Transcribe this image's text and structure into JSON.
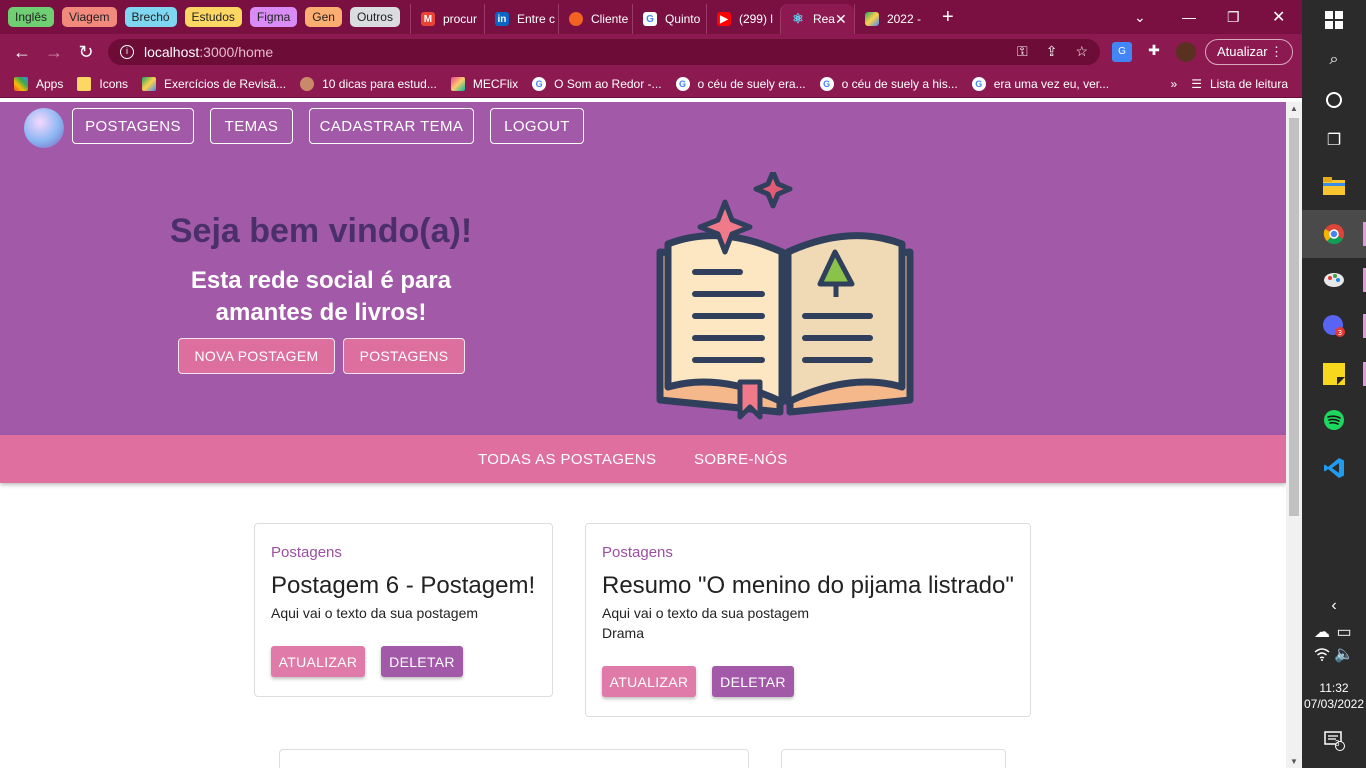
{
  "browser": {
    "tab_groups": [
      {
        "label": "Inglês",
        "color": "#6fcf72"
      },
      {
        "label": "Viagem",
        "color": "#f2897d"
      },
      {
        "label": "Brechó",
        "color": "#7ed6f0"
      },
      {
        "label": "Estudos",
        "color": "#fdd663"
      },
      {
        "label": "Figma",
        "color": "#d98cf5"
      },
      {
        "label": "Gen",
        "color": "#fcad70"
      },
      {
        "label": "Outros",
        "color": "#dadce0"
      }
    ],
    "tabs": [
      {
        "label": "procur",
        "icon": "gmail-icon",
        "color": "#ea4335"
      },
      {
        "label": "Entre c",
        "icon": "linkedin-icon",
        "color": "#0a66c2"
      },
      {
        "label": "Cliente",
        "icon": "app-icon",
        "color": "#f26322"
      },
      {
        "label": "Quinto",
        "icon": "g-icon",
        "color": "#4285f4"
      },
      {
        "label": "(299) l",
        "icon": "youtube-icon",
        "color": "#ff0000"
      },
      {
        "label": "Rea",
        "icon": "react-icon",
        "color": "#61dafb",
        "active": true
      },
      {
        "label": "2022 -",
        "icon": "drive-icon",
        "color": "#1fa463"
      }
    ],
    "url_host": "localhost",
    "url_path": ":3000/home",
    "update_label": "Atualizar",
    "bookmarks": [
      {
        "label": "Apps",
        "icon": "apps-grid-icon"
      },
      {
        "label": "Icons",
        "icon": "folder-icon"
      },
      {
        "label": "Exercícios de Revisã...",
        "icon": "drive-icon"
      },
      {
        "label": "10 dicas para estud...",
        "icon": "avatar-icon"
      },
      {
        "label": "MECFlix",
        "icon": "mecflix-icon"
      },
      {
        "label": "O Som ao Redor -...",
        "icon": "google-icon"
      },
      {
        "label": "o céu de suely era...",
        "icon": "google-icon"
      },
      {
        "label": "o céu de suely a his...",
        "icon": "google-icon"
      },
      {
        "label": "era uma vez eu, ver...",
        "icon": "google-icon"
      }
    ],
    "reading_list": "Lista de leitura"
  },
  "app": {
    "nav": [
      "POSTAGENS",
      "TEMAS",
      "CADASTRAR TEMA",
      "LOGOUT"
    ],
    "hero": {
      "title": "Seja bem vindo(a)!",
      "subtitle": "Esta rede social é para amantes de livros!",
      "new_post_button": "NOVA POSTAGEM",
      "posts_button": "POSTAGENS"
    },
    "subnav": [
      "TODAS AS POSTAGENS",
      "SOBRE-NÓS"
    ],
    "posts": [
      {
        "category": "Postagens",
        "title": "Postagem 6 - Postagem!",
        "text": "Aqui vai o texto da sua postagem",
        "theme": "",
        "update_label": "ATUALIZAR",
        "delete_label": "DELETAR"
      },
      {
        "category": "Postagens",
        "title": "Resumo \"O menino do pijama listrado\"",
        "text": "Aqui vai o texto da sua postagem",
        "theme": "Drama",
        "update_label": "ATUALIZAR",
        "delete_label": "DELETAR"
      }
    ],
    "colors": {
      "hero": "#a259a8",
      "accent_pink": "#de6f9f",
      "title_purple": "#4b2f6a"
    }
  },
  "taskbar": {
    "time": "11:32",
    "date": "07/03/2022",
    "notification_count": "3"
  }
}
